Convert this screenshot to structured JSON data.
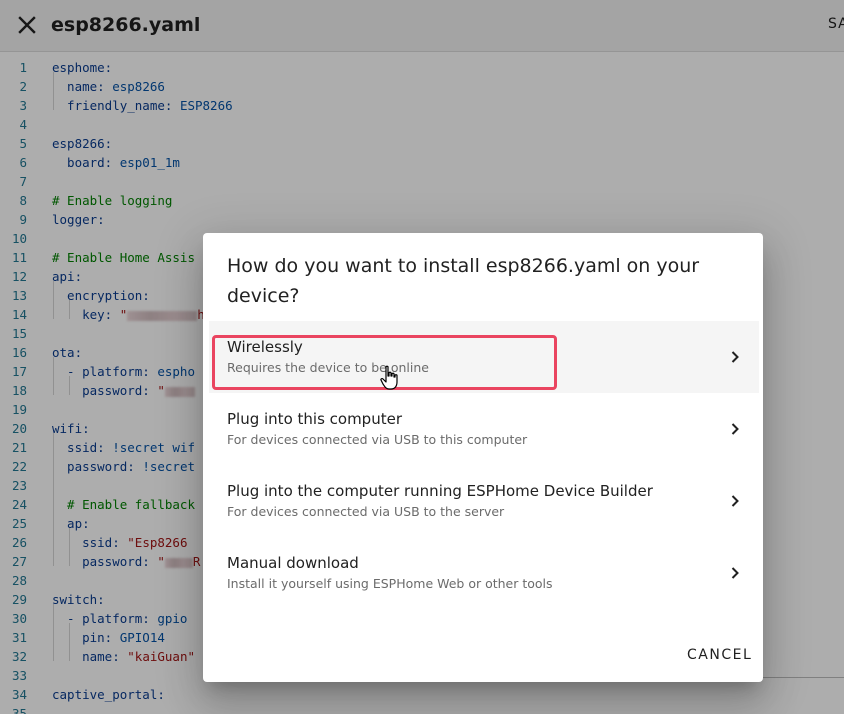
{
  "header": {
    "title": "esp8266.yaml",
    "save_label": "SA",
    "close_icon": "close-icon"
  },
  "editor": {
    "lines": [
      {
        "n": "1",
        "code": [
          {
            "t": "esphome:",
            "c": "k"
          }
        ]
      },
      {
        "n": "2",
        "code": [
          {
            "t": "  name: ",
            "c": "k"
          },
          {
            "t": "esp8266",
            "c": "v"
          }
        ]
      },
      {
        "n": "3",
        "code": [
          {
            "t": "  friendly_name: ",
            "c": "k"
          },
          {
            "t": "ESP8266",
            "c": "v"
          }
        ]
      },
      {
        "n": "4",
        "code": []
      },
      {
        "n": "5",
        "code": [
          {
            "t": "esp8266:",
            "c": "k"
          }
        ]
      },
      {
        "n": "6",
        "code": [
          {
            "t": "  board: ",
            "c": "k"
          },
          {
            "t": "esp01_1m",
            "c": "v"
          }
        ]
      },
      {
        "n": "7",
        "code": []
      },
      {
        "n": "8",
        "code": [
          {
            "t": "# Enable logging",
            "c": "c"
          }
        ]
      },
      {
        "n": "9",
        "code": [
          {
            "t": "logger:",
            "c": "k"
          }
        ]
      },
      {
        "n": "10",
        "code": []
      },
      {
        "n": "11",
        "code": [
          {
            "t": "# Enable Home Assis",
            "c": "c"
          }
        ]
      },
      {
        "n": "12",
        "code": [
          {
            "t": "api:",
            "c": "k"
          }
        ]
      },
      {
        "n": "13",
        "code": [
          {
            "t": "  encryption:",
            "c": "k"
          }
        ]
      },
      {
        "n": "14",
        "code": [
          {
            "t": "    key: ",
            "c": "k"
          },
          {
            "t": "\"",
            "c": "s"
          },
          {
            "redact": 70
          },
          {
            "t": "h",
            "c": "s"
          }
        ]
      },
      {
        "n": "15",
        "code": []
      },
      {
        "n": "16",
        "code": [
          {
            "t": "ota:",
            "c": "k"
          }
        ]
      },
      {
        "n": "17",
        "code": [
          {
            "t": "  - platform: ",
            "c": "k"
          },
          {
            "t": "espho",
            "c": "v"
          }
        ]
      },
      {
        "n": "18",
        "code": [
          {
            "t": "    password: ",
            "c": "k"
          },
          {
            "t": "\"",
            "c": "s"
          },
          {
            "redact": 30
          }
        ]
      },
      {
        "n": "19",
        "code": []
      },
      {
        "n": "20",
        "code": [
          {
            "t": "wifi:",
            "c": "k"
          }
        ]
      },
      {
        "n": "21",
        "code": [
          {
            "t": "  ssid: ",
            "c": "k"
          },
          {
            "t": "!secret wif",
            "c": "v"
          }
        ]
      },
      {
        "n": "22",
        "code": [
          {
            "t": "  password: ",
            "c": "k"
          },
          {
            "t": "!secret",
            "c": "v"
          }
        ]
      },
      {
        "n": "23",
        "code": []
      },
      {
        "n": "24",
        "code": [
          {
            "t": "  # Enable fallback",
            "c": "c"
          }
        ]
      },
      {
        "n": "25",
        "code": [
          {
            "t": "  ap:",
            "c": "k"
          }
        ]
      },
      {
        "n": "26",
        "code": [
          {
            "t": "    ssid: ",
            "c": "k"
          },
          {
            "t": "\"Esp8266",
            "c": "s"
          }
        ]
      },
      {
        "n": "27",
        "code": [
          {
            "t": "    password: ",
            "c": "k"
          },
          {
            "t": "\"",
            "c": "s"
          },
          {
            "redact": 28
          },
          {
            "t": "R",
            "c": "s"
          }
        ]
      },
      {
        "n": "28",
        "code": []
      },
      {
        "n": "29",
        "code": [
          {
            "t": "switch:",
            "c": "k"
          }
        ]
      },
      {
        "n": "30",
        "code": [
          {
            "t": "  - platform: ",
            "c": "k"
          },
          {
            "t": "gpio",
            "c": "v"
          }
        ]
      },
      {
        "n": "31",
        "code": [
          {
            "t": "    pin: ",
            "c": "k"
          },
          {
            "t": "GPIO14",
            "c": "v"
          }
        ]
      },
      {
        "n": "32",
        "code": [
          {
            "t": "    name: ",
            "c": "k"
          },
          {
            "t": "\"kaiGuan\"",
            "c": "s"
          }
        ]
      },
      {
        "n": "33",
        "code": []
      },
      {
        "n": "34",
        "code": [
          {
            "t": "captive_portal:",
            "c": "k"
          }
        ]
      },
      {
        "n": "35",
        "code": []
      }
    ]
  },
  "dialog": {
    "title": "How do you want to install esp8266.yaml on your device?",
    "options": [
      {
        "title": "Wirelessly",
        "subtitle": "Requires the device to be online",
        "hover": true
      },
      {
        "title": "Plug into this computer",
        "subtitle": "For devices connected via USB to this computer",
        "hover": false
      },
      {
        "title": "Plug into the computer running ESPHome Device Builder",
        "subtitle": "For devices connected via USB to the server",
        "hover": false
      },
      {
        "title": "Manual download",
        "subtitle": "Install it yourself using ESPHome Web or other tools",
        "hover": false
      }
    ],
    "cancel_label": "CANCEL"
  },
  "colors": {
    "highlight": "#ea4560",
    "keyword": "#0a3c8f",
    "string": "#a31515",
    "comment": "#008000"
  }
}
